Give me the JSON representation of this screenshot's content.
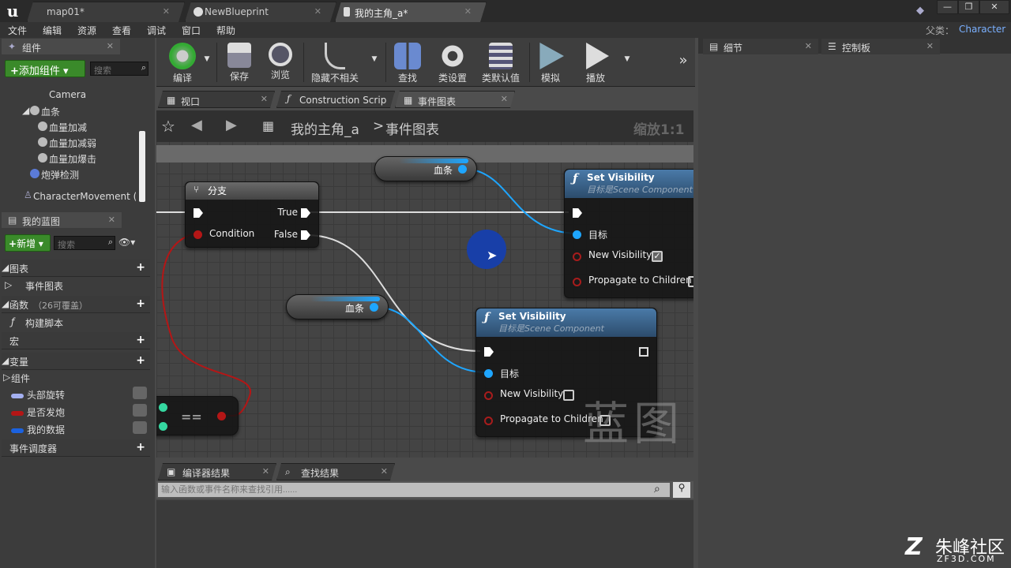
{
  "tabs": [
    {
      "label": "map01*"
    },
    {
      "label": "NewBlueprint"
    },
    {
      "label": "我的主角_a*"
    }
  ],
  "window_controls": [
    "—",
    "❐",
    "✕"
  ],
  "menu": [
    "文件",
    "编辑",
    "资源",
    "查看",
    "调试",
    "窗口",
    "帮助"
  ],
  "parent_class": {
    "label": "父类：",
    "value": "Character"
  },
  "components_panel": {
    "title": "组件",
    "add_button": "添加组件",
    "search_placeholder": "搜索",
    "tree": [
      "Camera",
      "血条",
      "血量加减",
      "血量加减弱",
      "血量加爆击",
      "炮弹检测",
      "CharacterMovement (继"
    ]
  },
  "myblueprint_panel": {
    "title": "我的蓝图",
    "new_button": "新增",
    "search_placeholder": "搜索",
    "sections": {
      "graphs": "图表",
      "event_graph": "事件图表",
      "functions": "函数",
      "functions_note": "（26可覆盖）",
      "construct_script": "构建脚本",
      "macros": "宏",
      "variables": "变量",
      "components": "组件",
      "event_dispatchers": "事件调度器"
    },
    "variables": [
      {
        "name": "头部旋转",
        "color": "#a4b0f0"
      },
      {
        "name": "是否发炮",
        "color": "#b41616"
      },
      {
        "name": "我的数据",
        "color": "#1b62e0"
      }
    ]
  },
  "toolbar": [
    "编译",
    "保存",
    "浏览",
    "隐藏不相关",
    "查找",
    "类设置",
    "类默认值",
    "模拟",
    "播放"
  ],
  "graph_tabs": [
    "视口",
    "Construction Scrip",
    "事件图表"
  ],
  "breadcrumb": {
    "root": "我的主角_a",
    "sep": ">",
    "current": "事件图表",
    "zoom": "缩放1:1"
  },
  "nodes": {
    "branch": {
      "title": "分支",
      "true": "True",
      "false": "False",
      "condition": "Condition"
    },
    "setvis1": {
      "title": "Set Visibility",
      "subtitle": "目标是Scene Component",
      "target": "目标",
      "new_visibility": "New Visibility",
      "propagate": "Propagate to Children"
    },
    "setvis2": {
      "title": "Set Visibility",
      "subtitle": "目标是Scene Component",
      "target": "目标",
      "new_visibility": "New Visibility",
      "propagate": "Propagate to Children"
    },
    "var1": "血条",
    "var2": "血条",
    "equals": "=="
  },
  "watermark": "蓝图",
  "bottom_tabs": [
    "编译器结果",
    "查找结果"
  ],
  "find_placeholder": "输入函数或事件名称来查找引用......",
  "right_tabs": [
    "细节",
    "控制板"
  ],
  "site_logo": {
    "name": "朱峰社区",
    "url": "ZF3D.COM"
  }
}
